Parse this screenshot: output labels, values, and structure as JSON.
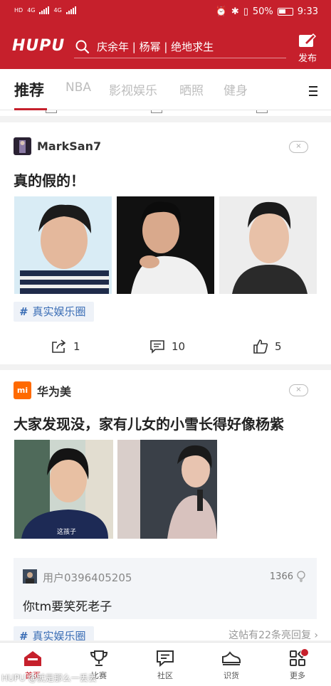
{
  "status_bar": {
    "left_labels": [
      "HD",
      "4G",
      "4G"
    ],
    "battery": "50%",
    "time": "9:33"
  },
  "header": {
    "logo": "HUPU",
    "search_placeholder": "庆余年 | 杨幂 | 绝地求生",
    "publish_label": "发布"
  },
  "tabs": [
    {
      "label": "推荐",
      "active": true
    },
    {
      "label": "NBA"
    },
    {
      "label": "影视娱乐"
    },
    {
      "label": "晒照"
    },
    {
      "label": "健身"
    }
  ],
  "posts": [
    {
      "author": "MarkSan7",
      "close_label": "×",
      "title": "真的假的！",
      "tag": "真实娱乐圈",
      "tag_symbol": "#",
      "shares": "1",
      "comments": "10",
      "likes": "5"
    },
    {
      "author": "华为美",
      "author_badge": "mi",
      "close_label": "×",
      "title": "大家发现没，家有儿女的小雪长得好像杨紫",
      "image_caption": "这孩子",
      "top_reply": {
        "user": "用户0396405205",
        "likes": "1366",
        "text": "你tm要笑死老子"
      },
      "tag": "真实娱乐圈",
      "tag_symbol": "#",
      "more_replies": "这帖有22条亮回复 ›"
    }
  ],
  "bottom_nav": [
    {
      "label": "首页",
      "icon": "home-icon",
      "active": true
    },
    {
      "label": "比赛",
      "icon": "trophy-icon"
    },
    {
      "label": "社区",
      "icon": "chat-icon"
    },
    {
      "label": "识货",
      "icon": "sneaker-icon"
    },
    {
      "label": "更多",
      "icon": "grid-icon",
      "badge": true
    }
  ],
  "watermark": "HUPU @就是那么一丢丢",
  "colors": {
    "brand": "#c6202c",
    "tag_blue": "#3a6db5"
  }
}
